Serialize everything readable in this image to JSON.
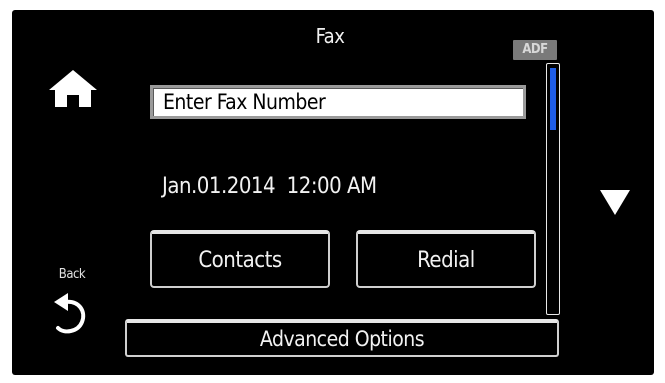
{
  "header": {
    "title": "Fax",
    "adf_badge": "ADF"
  },
  "fax_number": {
    "placeholder": "Enter Fax Number"
  },
  "status": {
    "datetime": "Jan.01.2014  12:00 AM"
  },
  "buttons": {
    "contacts": "Contacts",
    "redial": "Redial",
    "advanced_options": "Advanced Options"
  },
  "nav": {
    "home_icon": "home-icon",
    "back_label": "Back",
    "back_icon": "back-arrow-icon",
    "scroll_down_icon": "down-triangle-icon"
  },
  "scrollbar": {
    "position_fraction": 0.0
  },
  "colors": {
    "screen_background": "#000000",
    "text": "#f2f2f2",
    "scroll_thumb": "#1f5ee8",
    "badge_background": "#7a7a7a"
  }
}
